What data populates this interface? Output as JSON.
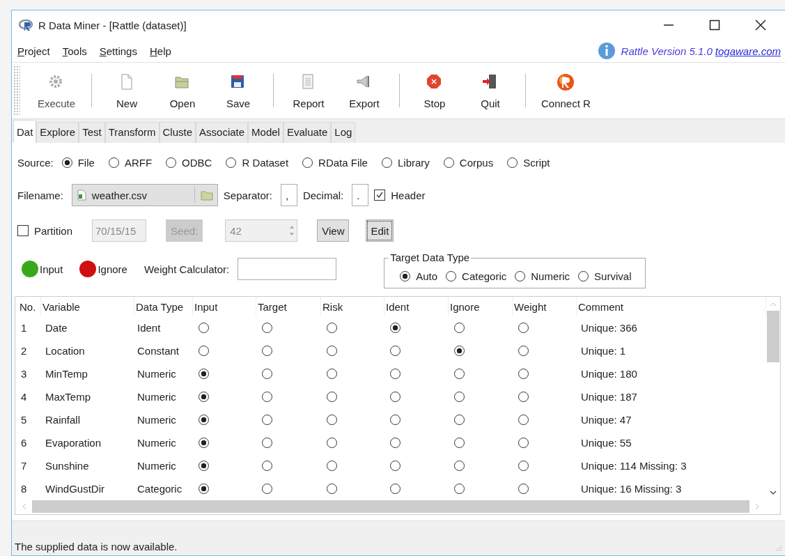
{
  "window": {
    "title": "R Data Miner - [Rattle (dataset)]"
  },
  "menu": [
    "Project",
    "Tools",
    "Settings",
    "Help"
  ],
  "version": {
    "text": "Rattle Version 5.1.0",
    "link": "togaware.com"
  },
  "toolbar": [
    [
      {
        "label": "Execute",
        "disabled": true
      }
    ],
    [
      {
        "label": "New",
        "disabled": false
      },
      {
        "label": "Open",
        "disabled": false
      },
      {
        "label": "Save",
        "disabled": false
      }
    ],
    [
      {
        "label": "Report",
        "disabled": false
      },
      {
        "label": "Export",
        "disabled": false
      }
    ],
    [
      {
        "label": "Stop",
        "disabled": false
      },
      {
        "label": "Quit",
        "disabled": false
      }
    ],
    [
      {
        "label": "Connect R",
        "disabled": false
      }
    ]
  ],
  "tabs": [
    {
      "label": "Dat",
      "selected": true
    },
    {
      "label": "Explore",
      "selected": false
    },
    {
      "label": "Test",
      "selected": false
    },
    {
      "label": "Transform",
      "selected": false
    },
    {
      "label": "Cluste",
      "selected": false
    },
    {
      "label": "Associate",
      "selected": false
    },
    {
      "label": "Model",
      "selected": false
    },
    {
      "label": "Evaluate",
      "selected": false
    },
    {
      "label": "Log",
      "selected": false
    }
  ],
  "source": {
    "label": "Source:",
    "options": [
      {
        "label": "File",
        "selected": true
      },
      {
        "label": "ARFF",
        "selected": false
      },
      {
        "label": "ODBC",
        "selected": false
      },
      {
        "label": "R Dataset",
        "selected": false
      },
      {
        "label": "RData File",
        "selected": false
      },
      {
        "label": "Library",
        "selected": false
      },
      {
        "label": "Corpus",
        "selected": false
      },
      {
        "label": "Script",
        "selected": false
      }
    ]
  },
  "file_row": {
    "filename_label": "Filename:",
    "filename": "weather.csv",
    "separator_label": "Separator:",
    "separator": ",",
    "decimal_label": "Decimal:",
    "decimal": ".",
    "header": {
      "label": "Header",
      "checked": true
    }
  },
  "partition_row": {
    "partition": {
      "label": "Partition",
      "checked": false
    },
    "split": {
      "value": "70/15/15",
      "disabled": true
    },
    "seed_button": {
      "label": "Seed:",
      "disabled": true
    },
    "seed": {
      "value": "42",
      "disabled": true
    },
    "view_button": {
      "label": "View",
      "focused": false
    },
    "edit_button": {
      "label": "Edit",
      "focused": true
    }
  },
  "legend": [
    {
      "label": "Input",
      "color": "#3aa81c"
    },
    {
      "label": "Ignore",
      "color": "#d01010"
    }
  ],
  "weight_calculator": {
    "label": "Weight Calculator:"
  },
  "target_data_type": {
    "title": "Target Data Type",
    "options": [
      {
        "label": "Auto",
        "selected": true
      },
      {
        "label": "Categoric",
        "selected": false
      },
      {
        "label": "Numeric",
        "selected": false
      },
      {
        "label": "Survival",
        "selected": false
      }
    ]
  },
  "table": {
    "columns": [
      "No.",
      "Variable",
      "Data Type",
      "Input",
      "Target",
      "Risk",
      "Ident",
      "Ignore",
      "Weight",
      "Comment"
    ],
    "rows": [
      {
        "no": "1",
        "variable": "Date",
        "data_type": "Ident",
        "roles": [
          {
            "selected": false
          },
          {
            "selected": false
          },
          {
            "selected": false
          },
          {
            "selected": true
          },
          {
            "selected": false
          },
          {
            "selected": false
          }
        ],
        "comment": "Unique: 366"
      },
      {
        "no": "2",
        "variable": "Location",
        "data_type": "Constant",
        "roles": [
          {
            "selected": false
          },
          {
            "selected": false
          },
          {
            "selected": false
          },
          {
            "selected": false
          },
          {
            "selected": true
          },
          {
            "selected": false
          }
        ],
        "comment": "Unique: 1"
      },
      {
        "no": "3",
        "variable": "MinTemp",
        "data_type": "Numeric",
        "roles": [
          {
            "selected": true
          },
          {
            "selected": false
          },
          {
            "selected": false
          },
          {
            "selected": false
          },
          {
            "selected": false
          },
          {
            "selected": false
          }
        ],
        "comment": "Unique: 180"
      },
      {
        "no": "4",
        "variable": "MaxTemp",
        "data_type": "Numeric",
        "roles": [
          {
            "selected": true
          },
          {
            "selected": false
          },
          {
            "selected": false
          },
          {
            "selected": false
          },
          {
            "selected": false
          },
          {
            "selected": false
          }
        ],
        "comment": "Unique: 187"
      },
      {
        "no": "5",
        "variable": "Rainfall",
        "data_type": "Numeric",
        "roles": [
          {
            "selected": true
          },
          {
            "selected": false
          },
          {
            "selected": false
          },
          {
            "selected": false
          },
          {
            "selected": false
          },
          {
            "selected": false
          }
        ],
        "comment": "Unique: 47"
      },
      {
        "no": "6",
        "variable": "Evaporation",
        "data_type": "Numeric",
        "roles": [
          {
            "selected": true
          },
          {
            "selected": false
          },
          {
            "selected": false
          },
          {
            "selected": false
          },
          {
            "selected": false
          },
          {
            "selected": false
          }
        ],
        "comment": "Unique: 55"
      },
      {
        "no": "7",
        "variable": "Sunshine",
        "data_type": "Numeric",
        "roles": [
          {
            "selected": true
          },
          {
            "selected": false
          },
          {
            "selected": false
          },
          {
            "selected": false
          },
          {
            "selected": false
          },
          {
            "selected": false
          }
        ],
        "comment": "Unique: 114 Missing: 3"
      },
      {
        "no": "8",
        "variable": "WindGustDir",
        "data_type": "Categoric",
        "roles": [
          {
            "selected": true
          },
          {
            "selected": false
          },
          {
            "selected": false
          },
          {
            "selected": false
          },
          {
            "selected": false
          },
          {
            "selected": false
          }
        ],
        "comment": "Unique: 16 Missing: 3"
      }
    ]
  },
  "status_bar": "The supplied data is now available."
}
